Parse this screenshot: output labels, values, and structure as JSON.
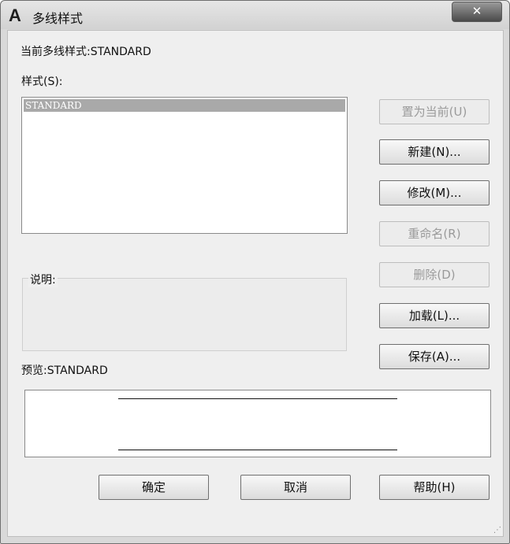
{
  "window": {
    "title": "多线样式",
    "app_icon": "A",
    "close_glyph": "✕"
  },
  "current_style_label": "当前多线样式:STANDARD",
  "styles_label": "样式(S):",
  "styles_list": {
    "items": [
      "STANDARD"
    ],
    "selected": "STANDARD"
  },
  "description_label": "说明:",
  "description_value": "",
  "preview_label": "预览:STANDARD",
  "buttons": {
    "set_current": "置为当前(U)",
    "new": "新建(N)...",
    "modify": "修改(M)...",
    "rename": "重命名(R)",
    "delete": "删除(D)",
    "load": "加载(L)...",
    "save": "保存(A)...",
    "ok": "确定",
    "cancel": "取消",
    "help": "帮助(H)"
  }
}
